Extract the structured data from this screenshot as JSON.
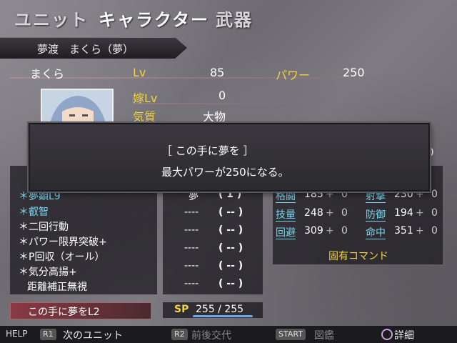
{
  "tabs": [
    "ユニット",
    "キャラクター",
    "武器"
  ],
  "name_banner": "夢渡　まくら（夢）",
  "char": {
    "name": "まくら",
    "lv_label": "Lv",
    "lv": "85",
    "power_label": "パワー",
    "power": "250",
    "yome_label": "嫁Lv",
    "yome": "0",
    "kishitsu_label": "気質",
    "kishitsu": "大物"
  },
  "dialog": {
    "line1": "［ この手に夢を ］",
    "line2": "最大パワーが250になる。"
  },
  "skills": [
    "＊夢顕L9",
    "＊叡智",
    "＊二回行動",
    "＊パワー限界突破+",
    "＊P回収（オール）",
    "＊気分高揚+",
    "距離補正無視"
  ],
  "mid_rows": [
    [
      "夢",
      "( 1 )"
    ],
    [
      "----",
      "( -- )"
    ],
    [
      "----",
      "( -- )"
    ],
    [
      "----",
      "( -- )"
    ],
    [
      "----",
      "( -- )"
    ],
    [
      "----",
      "( -- )"
    ],
    [
      "----",
      "( -- )"
    ]
  ],
  "stats": [
    {
      "name": "格闘",
      "val": "185",
      "plus": "+",
      "bonus": "0"
    },
    {
      "name": "射撃",
      "val": "230",
      "plus": "+",
      "bonus": "0"
    },
    {
      "name": "技量",
      "val": "248",
      "plus": "+",
      "bonus": "0"
    },
    {
      "name": "防御",
      "val": "194",
      "plus": "+",
      "bonus": "0"
    },
    {
      "name": "回避",
      "val": "309",
      "plus": "+",
      "bonus": "0"
    },
    {
      "name": "命中",
      "val": "351",
      "plus": "+",
      "bonus": "0"
    }
  ],
  "unique_cmd": "固有コマンド",
  "cmd": "この手に夢をL2",
  "sp_label": "SP",
  "sp": "255 / 255",
  "partial_digit": "0",
  "footer": {
    "help": "HELP",
    "r1": "R1",
    "r1_text": "次のユニット",
    "r2": "R2",
    "r2_text": "前後交代",
    "start": "START",
    "start_text": "図鑑",
    "circle_text": "詳細"
  }
}
